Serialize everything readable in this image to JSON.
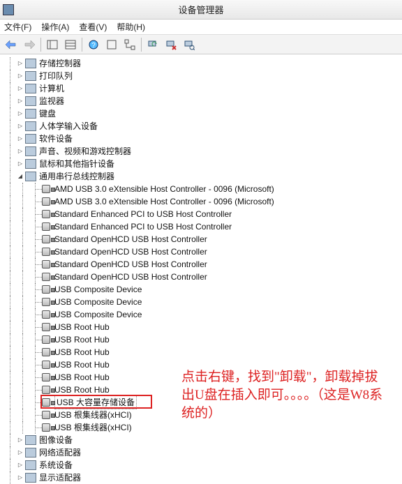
{
  "window": {
    "title": "设备管理器"
  },
  "menu": {
    "file": "文件(F)",
    "action": "操作(A)",
    "view": "查看(V)",
    "help": "帮助(H)"
  },
  "categories": {
    "storage_ctrl": "存储控制器",
    "print_queue": "打印队列",
    "computer": "计算机",
    "monitor": "监视器",
    "keyboard": "键盘",
    "hid": "人体学输入设备",
    "sw_device": "软件设备",
    "sound": "声音、视频和游戏控制器",
    "mouse": "鼠标和其他指针设备",
    "usb_bus": "通用串行总线控制器",
    "imaging": "图像设备",
    "net": "网络适配器",
    "system": "系统设备",
    "display": "显示适配器"
  },
  "usb_devices": [
    "AMD USB 3.0 eXtensible Host Controller - 0096 (Microsoft)",
    "AMD USB 3.0 eXtensible Host Controller - 0096 (Microsoft)",
    "Standard Enhanced PCI to USB Host Controller",
    "Standard Enhanced PCI to USB Host Controller",
    "Standard OpenHCD USB Host Controller",
    "Standard OpenHCD USB Host Controller",
    "Standard OpenHCD USB Host Controller",
    "Standard OpenHCD USB Host Controller",
    "USB Composite Device",
    "USB Composite Device",
    "USB Composite Device",
    "USB Root Hub",
    "USB Root Hub",
    "USB Root Hub",
    "USB Root Hub",
    "USB Root Hub",
    "USB Root Hub",
    "USB 大容量存储设备",
    "USB 根集线器(xHCI)",
    "USB 根集线器(xHCI)"
  ],
  "selected_device": "USB 大容量存储设备",
  "annotation": "点击右键，找到\"卸载\"，卸载掉拔出U盘在插入即可。。。。（这是W8系统的）",
  "colors": {
    "highlight": "#d22"
  }
}
